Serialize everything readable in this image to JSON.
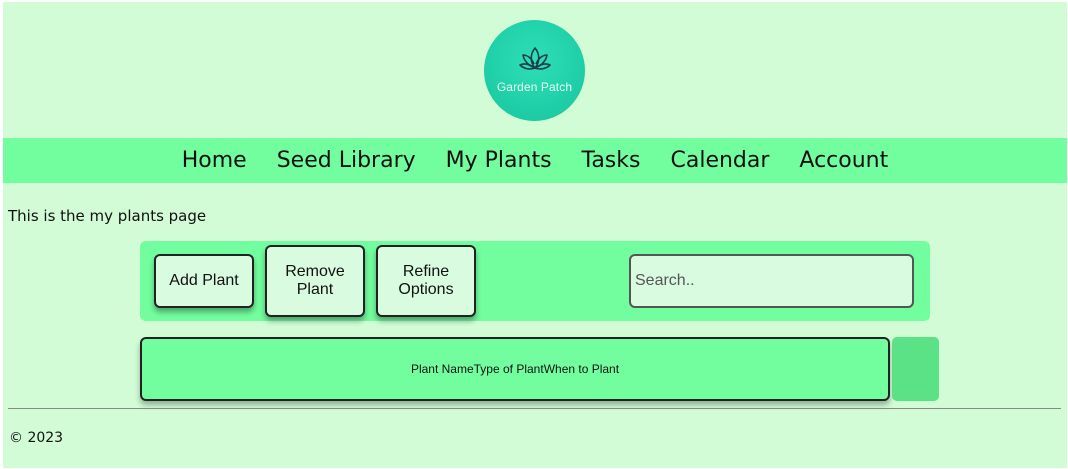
{
  "logo": {
    "text": "Garden Patch",
    "icon": "lotus-leaf-icon"
  },
  "nav": {
    "items": [
      {
        "label": "Home",
        "name": "nav-home"
      },
      {
        "label": "Seed Library",
        "name": "nav-seed-library"
      },
      {
        "label": "My Plants",
        "name": "nav-my-plants"
      },
      {
        "label": "Tasks",
        "name": "nav-tasks"
      },
      {
        "label": "Calendar",
        "name": "nav-calendar"
      },
      {
        "label": "Account",
        "name": "nav-account"
      }
    ]
  },
  "page": {
    "intro": "This is the my plants page"
  },
  "toolbar": {
    "add_label": "Add Plant",
    "remove_label": "Remove\nPlant",
    "refine_label": "Refine\nOptions",
    "search_placeholder": "Search.."
  },
  "table": {
    "columns": [
      "Plant Name",
      "Type of Plant",
      "When to Plant"
    ]
  },
  "footer": {
    "text": "© 2023"
  },
  "colors": {
    "page_bg": "#d1fcd6",
    "nav_bg": "#72fe9f",
    "logo_bg": "#1fcfa8"
  }
}
